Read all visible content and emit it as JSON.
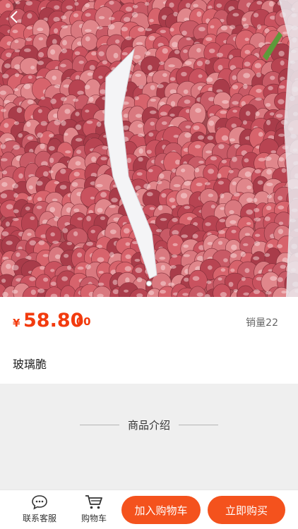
{
  "hero": {
    "image_alt": "",
    "back_icon": "chevron-left-icon",
    "carousel_dots": 1
  },
  "product": {
    "currency": "¥",
    "price_main": "58.80",
    "price_decimal": ".00",
    "sales": "销量22",
    "name": "玻璃脆"
  },
  "intro": {
    "title": "商品介绍"
  },
  "bottom_bar": {
    "service_label": "联系客服",
    "service_icon": "chat-icon",
    "cart_label": "购物车",
    "cart_icon": "cart-icon",
    "add_to_cart_label": "加入购物车",
    "buy_now_label": "立即购买"
  },
  "colors": {
    "accent": "#f4521d",
    "price": "#f23b0e",
    "background": "#efefef"
  }
}
